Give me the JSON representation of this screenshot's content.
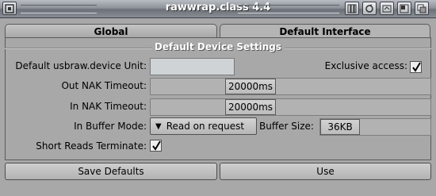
{
  "window": {
    "title": "rawwrap.class 4.4",
    "titlebar_buttons": [
      "iconify-icon",
      "snapshot-icon",
      "jump-icon",
      "zoom-icon",
      "depth-icon"
    ]
  },
  "tabs": [
    {
      "label": "Global",
      "active": false
    },
    {
      "label": "Default Interface",
      "active": true
    }
  ],
  "group": {
    "title": "Default Device Settings"
  },
  "fields": {
    "unit_label": "Default usbraw.device Unit:",
    "unit_value": "",
    "exclusive_label": "Exclusive access:",
    "exclusive_checked": true,
    "out_nak_label": "Out NAK Timeout:",
    "out_nak_value": "20000ms",
    "in_nak_label": "In NAK Timeout:",
    "in_nak_value": "20000ms",
    "buffer_mode_label": "In Buffer Mode:",
    "buffer_mode_value": "Read on request",
    "buffer_size_label": "Buffer Size:",
    "buffer_size_value": "36KB",
    "short_reads_label": "Short Reads Terminate:",
    "short_reads_checked": true
  },
  "buttons": {
    "save_defaults": "Save Defaults",
    "use": "Use"
  },
  "colors": {
    "window_bg": "#a8a8a8",
    "titlebar": "#7c8188",
    "title_text": "#ffffff"
  }
}
